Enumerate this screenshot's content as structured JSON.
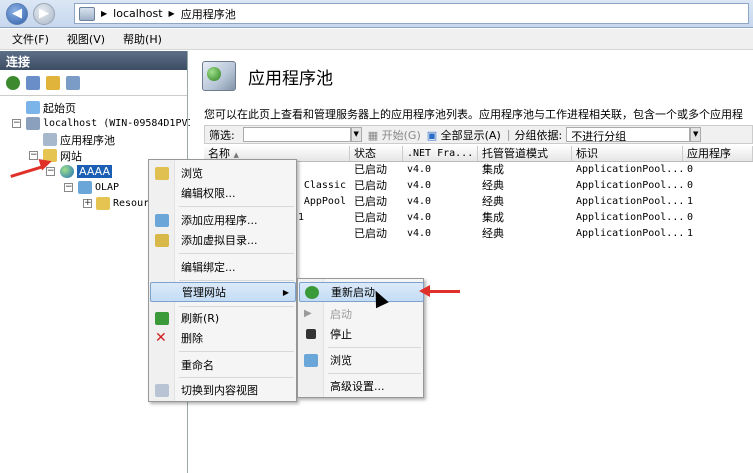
{
  "address": {
    "path": [
      "localhost",
      "应用程序池"
    ]
  },
  "menu": [
    "文件(F)",
    "视图(V)",
    "帮助(H)"
  ],
  "left": {
    "header": "连接",
    "tree": [
      {
        "label": "起始页"
      },
      {
        "label": "localhost (WIN-09584D1PVI"
      },
      {
        "label": "应用程序池"
      },
      {
        "label": "网站"
      },
      {
        "label": "AAAA"
      },
      {
        "label": "OLAP"
      },
      {
        "label": "Resour"
      }
    ]
  },
  "right": {
    "title": "应用程序池",
    "description": "您可以在此页上查看和管理服务器上的应用程序池列表。应用程序池与工作进程相关联，包含一个或多个应用程",
    "filter": {
      "label": "筛选:",
      "start": "开始(G)",
      "show_all": "全部显示(A)",
      "group_label": "分组依据:",
      "group_value": "不进行分组"
    },
    "columns": [
      "名称",
      "状态",
      ".NET Fra...",
      "托管管道模式",
      "标识",
      "应用程序"
    ],
    "rows": [
      {
        "name": "",
        "status": "已启动",
        "net": "v4.0",
        "mode": "集成",
        "identity": "ApplicationPool...",
        "apps": "0"
      },
      {
        "name": "Classic",
        "status": "已启动",
        "net": "v4.0",
        "mode": "经典",
        "identity": "ApplicationPool...",
        "apps": "0"
      },
      {
        "name": "AppPool",
        "status": "已启动",
        "net": "v4.0",
        "mode": "经典",
        "identity": "ApplicationPool...",
        "apps": "1"
      },
      {
        "name": "1",
        "status": "已启动",
        "net": "v4.0",
        "mode": "集成",
        "identity": "ApplicationPool...",
        "apps": "0"
      },
      {
        "name": "",
        "status": "已启动",
        "net": "v4.0",
        "mode": "经典",
        "identity": "ApplicationPool...",
        "apps": "1"
      }
    ]
  },
  "context_menu": {
    "items": [
      "浏览",
      "编辑权限...",
      "添加应用程序...",
      "添加虚拟目录...",
      "编辑绑定...",
      "管理网站",
      "刷新(R)",
      "删除",
      "重命名",
      "切换到内容视图"
    ]
  },
  "submenu": {
    "items": [
      "重新启动",
      "启动",
      "停止",
      "浏览",
      "高级设置..."
    ]
  }
}
